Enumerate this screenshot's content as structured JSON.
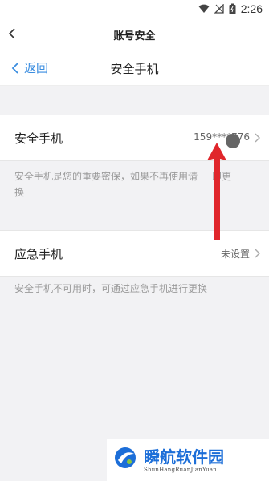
{
  "status_bar": {
    "time": "2:26"
  },
  "outer_header": {
    "title": "账号安全"
  },
  "inner_header": {
    "back_label": "返回",
    "title": "安全手机"
  },
  "rows": [
    {
      "label": "安全手机",
      "value": "159****7",
      "value_tail": "76"
    },
    {
      "label": "应急手机",
      "value": "未设置"
    }
  ],
  "hints": [
    {
      "part1": "安全手机是您的重要密保，如果不再使用请",
      "part2": "即更",
      "line2": "换"
    },
    {
      "text": "安全手机不可用时，可通过应急手机进行更换"
    }
  ],
  "watermark": {
    "text": "瞬航软件园",
    "subtext": "ShunHangRuanJianYuan"
  },
  "colors": {
    "accent": "#3a8de0",
    "arrow": "#e0262b"
  }
}
